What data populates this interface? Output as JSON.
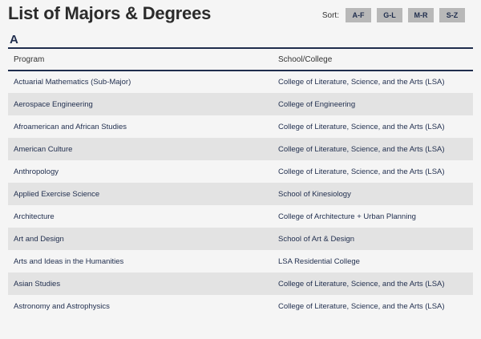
{
  "page_title": "List of Majors & Degrees",
  "sort": {
    "label": "Sort:",
    "buttons": [
      "A-F",
      "G-L",
      "M-R",
      "S-Z"
    ]
  },
  "section": {
    "letter": "A",
    "columns": [
      "Program",
      "School/College"
    ],
    "rows": [
      {
        "program": "Actuarial Mathematics (Sub-Major)",
        "school": "College of Literature, Science, and the Arts (LSA)"
      },
      {
        "program": "Aerospace Engineering",
        "school": "College of Engineering"
      },
      {
        "program": "Afroamerican and African Studies",
        "school": "College of Literature, Science, and the Arts (LSA)"
      },
      {
        "program": "American Culture",
        "school": "College of Literature, Science, and the Arts (LSA)"
      },
      {
        "program": "Anthropology",
        "school": "College of Literature, Science, and the Arts (LSA)"
      },
      {
        "program": "Applied Exercise Science",
        "school": "School of Kinesiology"
      },
      {
        "program": "Architecture",
        "school": "College of Architecture + Urban Planning"
      },
      {
        "program": "Art and Design",
        "school": "School of Art & Design"
      },
      {
        "program": "Arts and Ideas in the Humanities",
        "school": "LSA Residential College"
      },
      {
        "program": "Asian Studies",
        "school": "College of Literature, Science, and the Arts (LSA)"
      },
      {
        "program": "Astronomy and Astrophysics",
        "school": "College of Literature, Science, and the Arts (LSA)"
      }
    ]
  },
  "colors": {
    "navy": "#1f2d4d",
    "row_alt": "#e3e3e3",
    "button_bg": "#b8b8b8"
  }
}
